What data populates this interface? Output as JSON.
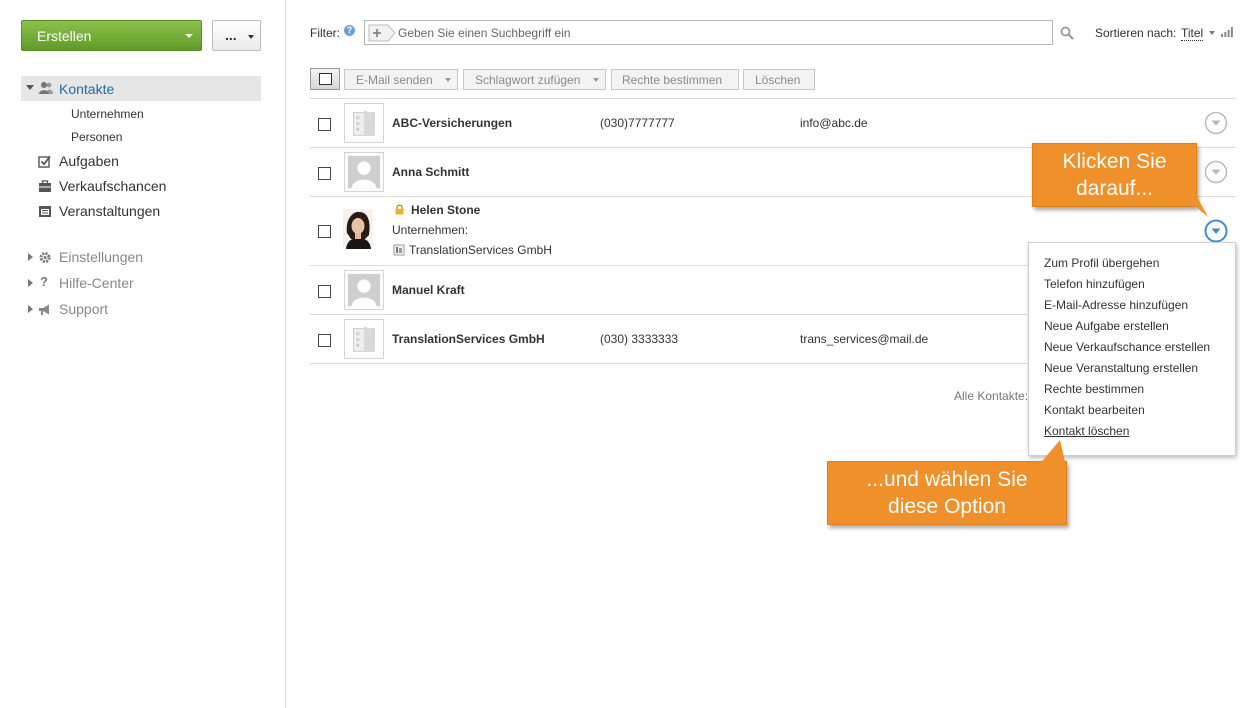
{
  "sidebar": {
    "create_label": "Erstellen",
    "more_label": "...",
    "nav": {
      "contacts": "Kontakte",
      "companies": "Unternehmen",
      "persons": "Personen",
      "tasks": "Aufgaben",
      "opportunities": "Verkaufschancen",
      "events": "Veranstaltungen",
      "settings": "Einstellungen",
      "help": "Hilfe-Center",
      "support": "Support"
    }
  },
  "filter": {
    "label": "Filter:",
    "help": "?",
    "placeholder": "Geben Sie einen Suchbegriff ein",
    "sort_label": "Sortieren nach:",
    "sort_value": "Titel"
  },
  "toolbar": {
    "email": "E-Mail senden",
    "tag": "Schlagwort zufügen",
    "rights": "Rechte bestimmen",
    "delete": "Löschen"
  },
  "contacts": [
    {
      "name": "ABC-Versicherungen",
      "phone": "(030)7777777",
      "email": "info@abc.de",
      "type": "company"
    },
    {
      "name": "Anna Schmitt",
      "phone": "",
      "email": "",
      "type": "person"
    },
    {
      "name": "Helen Stone",
      "company_label": "Unternehmen:",
      "company": "TranslationServices GmbH",
      "type": "person-photo",
      "locked": true
    },
    {
      "name": "Manuel Kraft",
      "phone": "",
      "email": "",
      "type": "person"
    },
    {
      "name": "TranslationServices GmbH",
      "phone": "(030) 3333333",
      "email": "trans_services@mail.de",
      "type": "company"
    }
  ],
  "footer": {
    "all_contacts": "Alle Kontakte:"
  },
  "context_menu": [
    "Zum Profil übergehen",
    "Telefon hinzufügen",
    "E-Mail-Adresse hinzufügen",
    "Neue Aufgabe erstellen",
    "Neue Verkaufschance erstellen",
    "Neue Veranstaltung erstellen",
    "Rechte bestimmen",
    "Kontakt bearbeiten",
    "Kontakt löschen"
  ],
  "callouts": {
    "first": [
      "Klicken Sie",
      "darauf..."
    ],
    "second": [
      "...und wählen Sie",
      "diese Option"
    ]
  },
  "colors": {
    "accent_green": "#6aa733",
    "link_blue": "#1b6fa8",
    "callout_orange": "#f0902a",
    "menu_active_blue": "#3b8fd0"
  }
}
